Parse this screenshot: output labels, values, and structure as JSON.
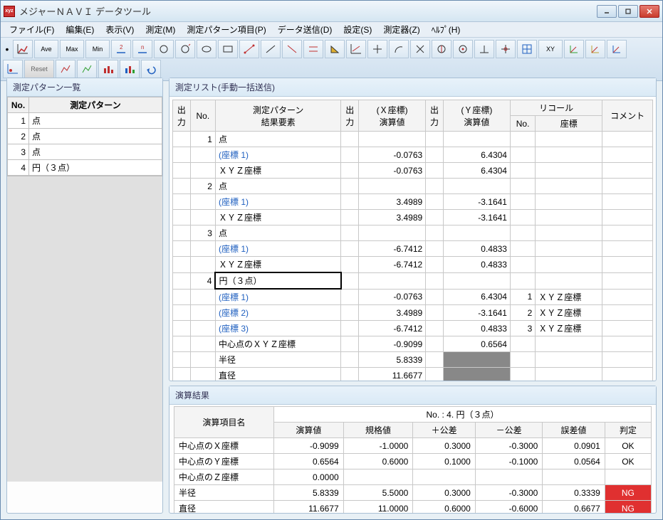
{
  "window": {
    "title": "メジャーＮＡＶＩ データツール"
  },
  "menu": {
    "file": "ファイル(F)",
    "edit": "編集(E)",
    "view": "表示(V)",
    "measure": "測定(M)",
    "pattern_item": "測定パターン項目(P)",
    "data_send": "データ送信(D)",
    "settings": "設定(S)",
    "instrument": "測定器(Z)",
    "help": "ﾍﾙﾌﾟ(H)"
  },
  "toolbar": {
    "ave": "Ave",
    "max": "Max",
    "min": "Min",
    "reset": "Reset",
    "xy": "XY"
  },
  "left_pane": {
    "title": "測定パターン一覧",
    "col_no": "No.",
    "col_pattern": "測定パターン",
    "rows": [
      {
        "no": "1",
        "name": "点"
      },
      {
        "no": "2",
        "name": "点"
      },
      {
        "no": "3",
        "name": "点"
      },
      {
        "no": "4",
        "name": "円（３点）"
      }
    ]
  },
  "list_pane": {
    "title": "測定リスト(手動一括送信)",
    "headers": {
      "out1": "出力",
      "no": "No.",
      "pattern": "測定パターン\n結果要素",
      "out2": "出力",
      "xval": "(Ｘ座標)\n演算値",
      "out3": "出力",
      "yval": "(Ｙ座標)\n演算値",
      "recall": "リコール",
      "rno": "No.",
      "coord": "座標",
      "comment": "コメント"
    },
    "rows": [
      {
        "no": "1",
        "label": "点",
        "x": "",
        "y": "",
        "rno": "",
        "coord": ""
      },
      {
        "no": "",
        "label": "(座標 1)",
        "link": true,
        "x": "-0.0763",
        "y": "6.4304",
        "rno": "",
        "coord": ""
      },
      {
        "no": "",
        "label": "ＸＹＺ座標",
        "x": "-0.0763",
        "y": "6.4304",
        "rno": "",
        "coord": ""
      },
      {
        "no": "2",
        "label": "点",
        "x": "",
        "y": "",
        "rno": "",
        "coord": ""
      },
      {
        "no": "",
        "label": "(座標 1)",
        "link": true,
        "x": "3.4989",
        "y": "-3.1641",
        "rno": "",
        "coord": ""
      },
      {
        "no": "",
        "label": "ＸＹＺ座標",
        "x": "3.4989",
        "y": "-3.1641",
        "rno": "",
        "coord": ""
      },
      {
        "no": "3",
        "label": "点",
        "x": "",
        "y": "",
        "rno": "",
        "coord": ""
      },
      {
        "no": "",
        "label": "(座標 1)",
        "link": true,
        "x": "-6.7412",
        "y": "0.4833",
        "rno": "",
        "coord": ""
      },
      {
        "no": "",
        "label": "ＸＹＺ座標",
        "x": "-6.7412",
        "y": "0.4833",
        "rno": "",
        "coord": ""
      },
      {
        "no": "4",
        "label": "円（３点）",
        "hl": true,
        "x": "",
        "y": "",
        "rno": "",
        "coord": ""
      },
      {
        "no": "",
        "label": "(座標 1)",
        "link": true,
        "x": "-0.0763",
        "y": "6.4304",
        "rno": "1",
        "coord": "ＸＹＺ座標"
      },
      {
        "no": "",
        "label": "(座標 2)",
        "link": true,
        "x": "3.4989",
        "y": "-3.1641",
        "rno": "2",
        "coord": "ＸＹＺ座標"
      },
      {
        "no": "",
        "label": "(座標 3)",
        "link": true,
        "x": "-6.7412",
        "y": "0.4833",
        "rno": "3",
        "coord": "ＸＹＺ座標"
      },
      {
        "no": "",
        "label": "中心点のＸＹＺ座標",
        "x": "-0.9099",
        "y": "0.6564",
        "rno": "",
        "coord": ""
      },
      {
        "no": "",
        "label": "半径",
        "x": "5.8339",
        "y": "",
        "grey_y": true,
        "rno": "",
        "coord": ""
      },
      {
        "no": "",
        "label": "直径",
        "x": "11.6677",
        "y": "",
        "grey_y": true,
        "rno": "",
        "coord": ""
      }
    ]
  },
  "result_pane": {
    "title": "演算結果",
    "header_line": "No. :   4. 円（３点）",
    "col_item": "演算項目名",
    "col_calc": "演算値",
    "col_spec": "規格値",
    "col_plus": "＋公差",
    "col_minus": "－公差",
    "col_err": "誤差値",
    "col_judge": "判定",
    "rows": [
      {
        "item": "中心点のＸ座標",
        "calc": "-0.9099",
        "spec": "-1.0000",
        "plus": "0.3000",
        "minus": "-0.3000",
        "err": "0.0901",
        "judge": "OK",
        "ng": false
      },
      {
        "item": "中心点のＹ座標",
        "calc": "0.6564",
        "spec": "0.6000",
        "plus": "0.1000",
        "minus": "-0.1000",
        "err": "0.0564",
        "judge": "OK",
        "ng": false
      },
      {
        "item": "中心点のＺ座標",
        "calc": "0.0000",
        "spec": "",
        "plus": "",
        "minus": "",
        "err": "",
        "judge": "",
        "ng": false
      },
      {
        "item": "半径",
        "calc": "5.8339",
        "spec": "5.5000",
        "plus": "0.3000",
        "minus": "-0.3000",
        "err": "0.3339",
        "judge": "NG",
        "ng": true
      },
      {
        "item": "直径",
        "calc": "11.6677",
        "spec": "11.0000",
        "plus": "0.6000",
        "minus": "-0.6000",
        "err": "0.6677",
        "judge": "NG",
        "ng": true
      }
    ]
  }
}
